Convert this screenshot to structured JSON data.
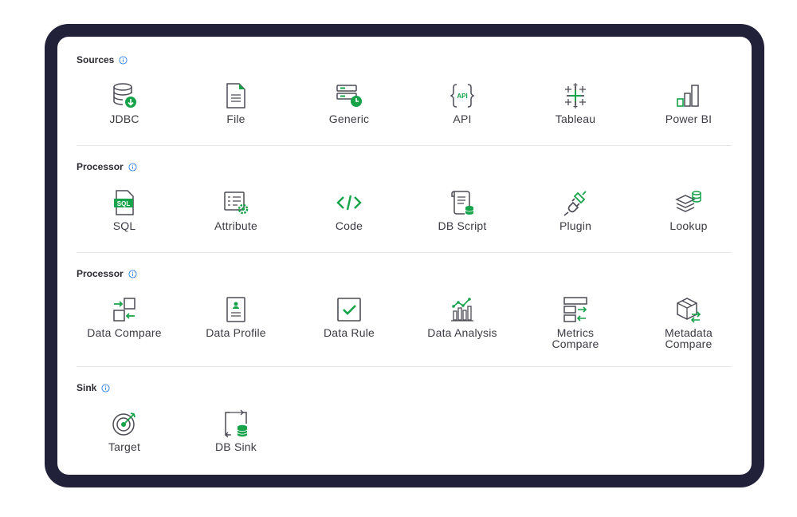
{
  "colors": {
    "frame": "#21213a",
    "accent": "#16a34a",
    "icon_stroke": "#4b4b55",
    "text": "#3b3b44"
  },
  "sections": [
    {
      "title": "Sources",
      "info_icon": "info-icon",
      "tiles": [
        {
          "label": "JDBC",
          "icon": "database-download-icon"
        },
        {
          "label": "File",
          "icon": "file-icon"
        },
        {
          "label": "Generic",
          "icon": "server-clock-icon"
        },
        {
          "label": "API",
          "icon": "api-icon"
        },
        {
          "label": "Tableau",
          "icon": "tableau-icon"
        },
        {
          "label": "Power BI",
          "icon": "power-bi-icon"
        }
      ]
    },
    {
      "title": "Processor",
      "info_icon": "info-icon",
      "tiles": [
        {
          "label": "SQL",
          "icon": "sql-file-icon"
        },
        {
          "label": "Attribute",
          "icon": "attribute-gear-icon"
        },
        {
          "label": "Code",
          "icon": "code-icon"
        },
        {
          "label": "DB Script",
          "icon": "db-script-icon"
        },
        {
          "label": "Plugin",
          "icon": "plugin-icon"
        },
        {
          "label": "Lookup",
          "icon": "lookup-layers-icon"
        }
      ]
    },
    {
      "title": "Processor",
      "info_icon": "info-icon",
      "tiles": [
        {
          "label": "Data Compare",
          "icon": "data-compare-icon"
        },
        {
          "label": "Data Profile",
          "icon": "data-profile-icon"
        },
        {
          "label": "Data Rule",
          "icon": "checkbox-icon"
        },
        {
          "label": "Data Analysis",
          "icon": "data-analysis-icon"
        },
        {
          "label": "Metrics Compare",
          "icon": "metrics-compare-icon"
        },
        {
          "label": "Metadata Compare",
          "icon": "metadata-compare-icon"
        }
      ]
    },
    {
      "title": "Sink",
      "info_icon": "info-icon",
      "tiles": [
        {
          "label": "Target",
          "icon": "target-icon"
        },
        {
          "label": "DB Sink",
          "icon": "db-sink-icon"
        }
      ]
    }
  ]
}
